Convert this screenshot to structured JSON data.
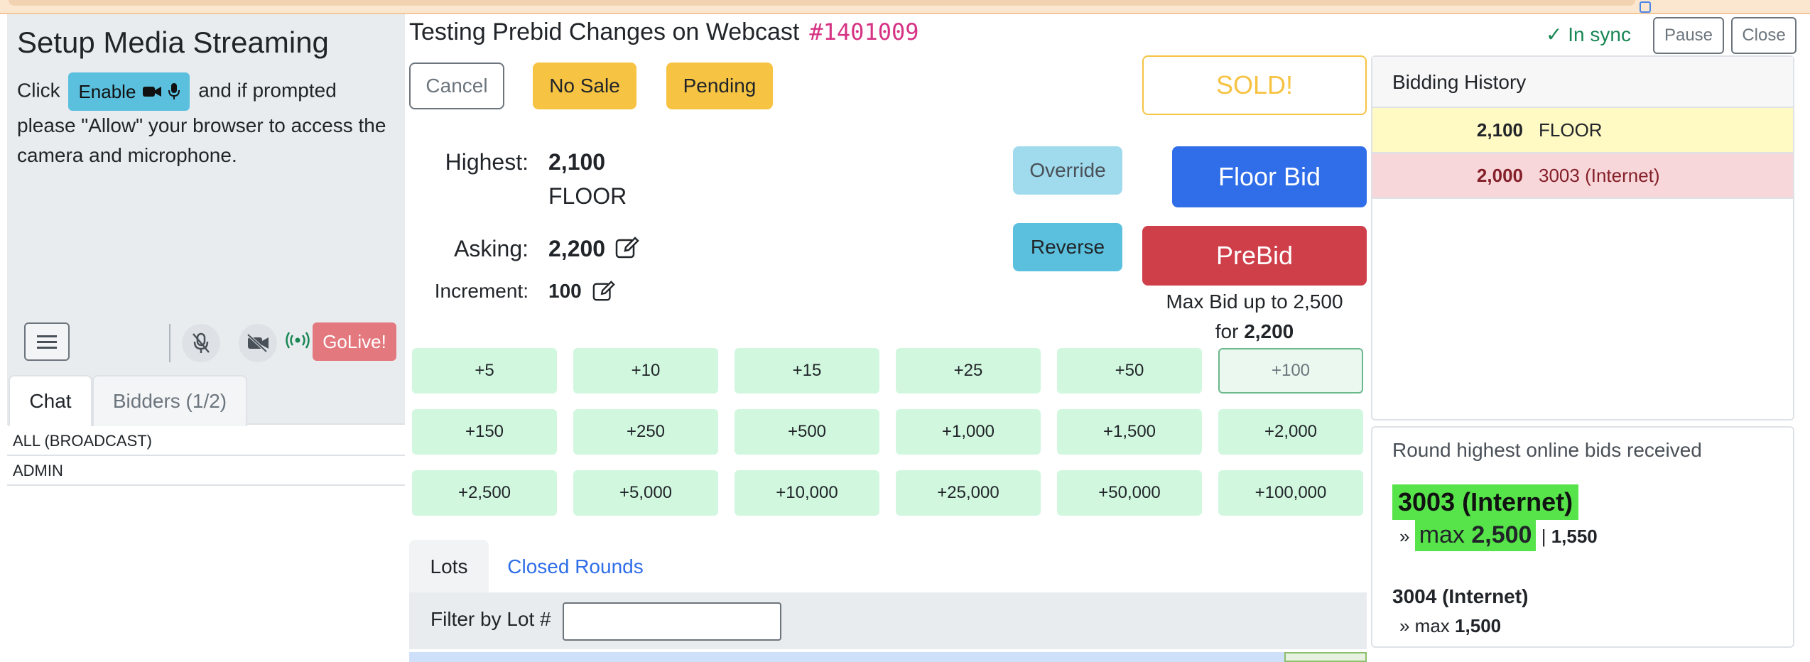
{
  "setup": {
    "title": "Setup Media Streaming",
    "click": "Click",
    "enable_label": "Enable",
    "instruction_rest": "and if prompted please \"Allow\" your browser to access the camera and microphone.",
    "golive_label": "GoLive!"
  },
  "chat": {
    "tabs": [
      "Chat",
      "Bidders (1/2)"
    ],
    "recipients": [
      "ALL (BROADCAST)",
      "ADMIN"
    ]
  },
  "lot": {
    "title": "Testing Prebid Changes on Webcast",
    "number": "#1401009"
  },
  "actions": {
    "cancel": "Cancel",
    "no_sale": "No Sale",
    "pending": "Pending",
    "sold": "SOLD!",
    "override": "Override",
    "reverse": "Reverse",
    "floor_bid": "Floor Bid",
    "prebid": "PreBid"
  },
  "bid": {
    "highest_label": "Highest:",
    "highest_value": "2,100",
    "highest_source": "FLOOR",
    "asking_label": "Asking:",
    "asking_value": "2,200",
    "increment_label": "Increment:",
    "increment_value": "100",
    "maxbid_text": "Max Bid up to 2,500",
    "maxbid_for": "for",
    "maxbid_for_value": "2,200"
  },
  "increments": [
    "+5",
    "+10",
    "+15",
    "+25",
    "+50",
    "+100",
    "+150",
    "+250",
    "+500",
    "+1,000",
    "+1,500",
    "+2,000",
    "+2,500",
    "+5,000",
    "+10,000",
    "+25,000",
    "+50,000",
    "+100,000"
  ],
  "lots_tabs": [
    "Lots",
    "Closed Rounds"
  ],
  "filter_label": "Filter by Lot #",
  "status": {
    "sync": "✓ In sync",
    "pause": "Pause",
    "close": "Close"
  },
  "history": {
    "title": "Bidding History",
    "rows": [
      {
        "amount": "2,100",
        "bidder": "FLOOR"
      },
      {
        "amount": "2,000",
        "bidder": "3003 (Internet)"
      }
    ]
  },
  "round": {
    "title": "Round highest online bids received",
    "top_bidder": "3003 (Internet)",
    "top_prefix": "» ",
    "top_max_label": "max",
    "top_max": "2,500",
    "top_sep": "| ",
    "top_current": "1,550",
    "second_bidder": "3004 (Internet)",
    "second_max_text": "» max",
    "second_max": "1,500"
  },
  "colors": {
    "floor_bid": "#2f6ee8",
    "prebid": "#cf3f4a",
    "sold": "#f6c343",
    "increment_bg": "#d1f7df",
    "highlight": "#57e34a",
    "sync": "#198754"
  }
}
